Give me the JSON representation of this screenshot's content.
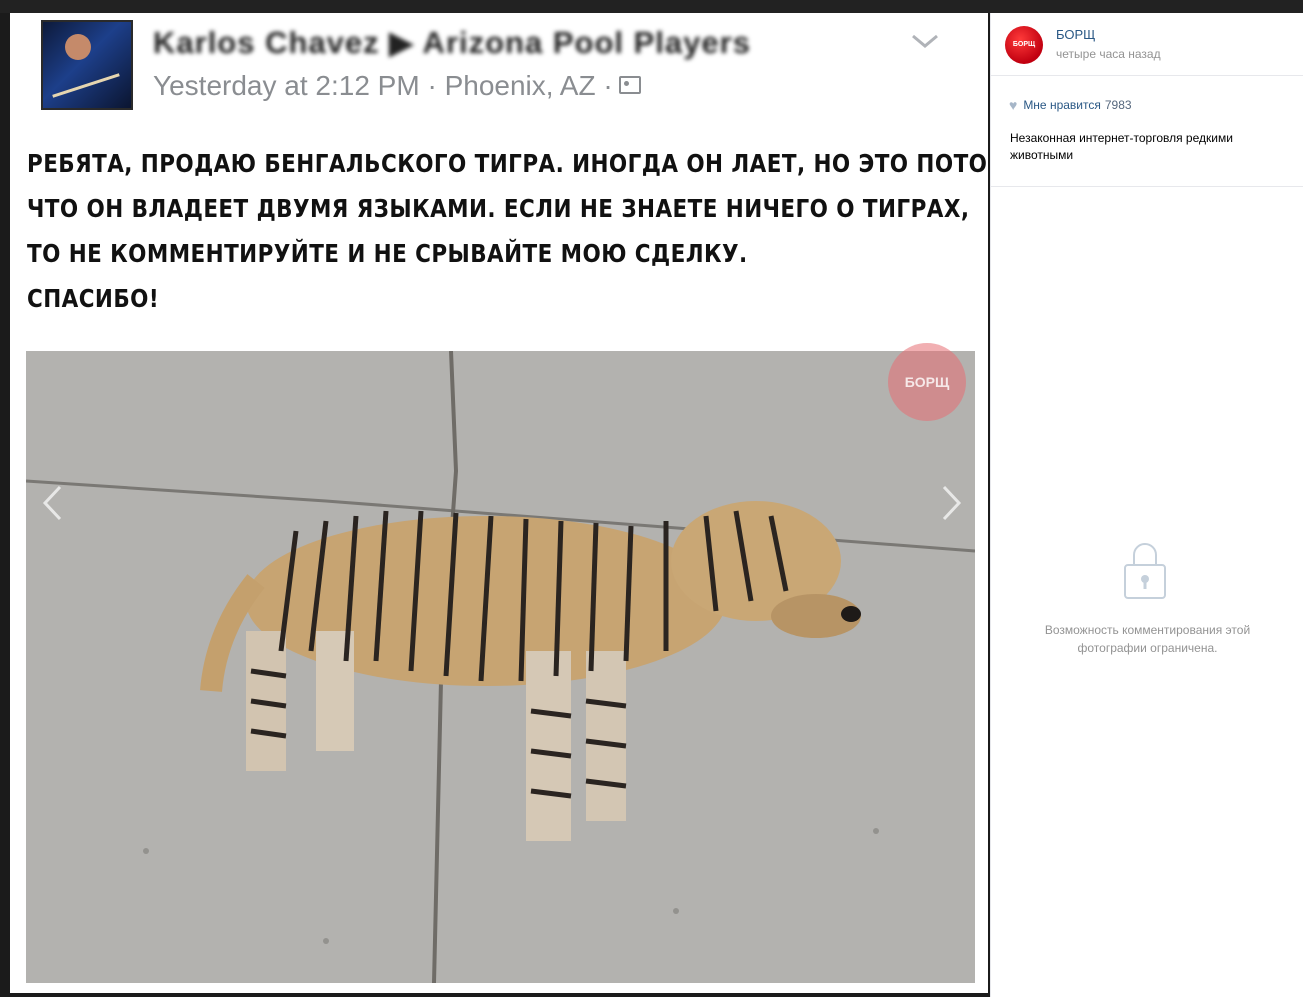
{
  "post": {
    "author_name": "Karlos Chavez ▶ Arizona Pool Players",
    "meta": "Yesterday at 2:12 PM · Phoenix, AZ ·",
    "text_lines": [
      "РЕБЯТА, ПРОДАЮ БЕНГАЛЬСКОГО ТИГРА. ИНОГДА ОН ЛАЕТ, НО ЭТО ПОТОМУ,",
      "ЧТО ОН ВЛАДЕЕТ ДВУМЯ ЯЗЫКАМИ. ЕСЛИ НЕ ЗНАЕТЕ НИЧЕГО О ТИГРАХ,",
      "ТО НЕ КОММЕНТИРУЙТЕ И НЕ СРЫВАЙТЕ МОЮ СДЕЛКУ.",
      "СПАСИБО!"
    ],
    "watermark": "БОРЩ"
  },
  "sidebar": {
    "group_logo_text": "БОРЩ",
    "group_name": "БОРЩ",
    "post_time": "четыре часа назад",
    "likes_label": "Мне нравится",
    "likes_count": "7983",
    "caption": "Незаконная интернет-торговля редкими животными",
    "restricted_text": "Возможность комментирования этой фотографии ограничена."
  },
  "icons": {
    "chevron": "chevron-down-icon",
    "privacy": "friends-icon",
    "heart": "heart-icon",
    "lock": "lock-icon",
    "prev": "chevron-left-icon",
    "next": "chevron-right-icon"
  },
  "colors": {
    "link": "#2a5885",
    "muted": "#939393",
    "brand_red": "#c10010"
  }
}
